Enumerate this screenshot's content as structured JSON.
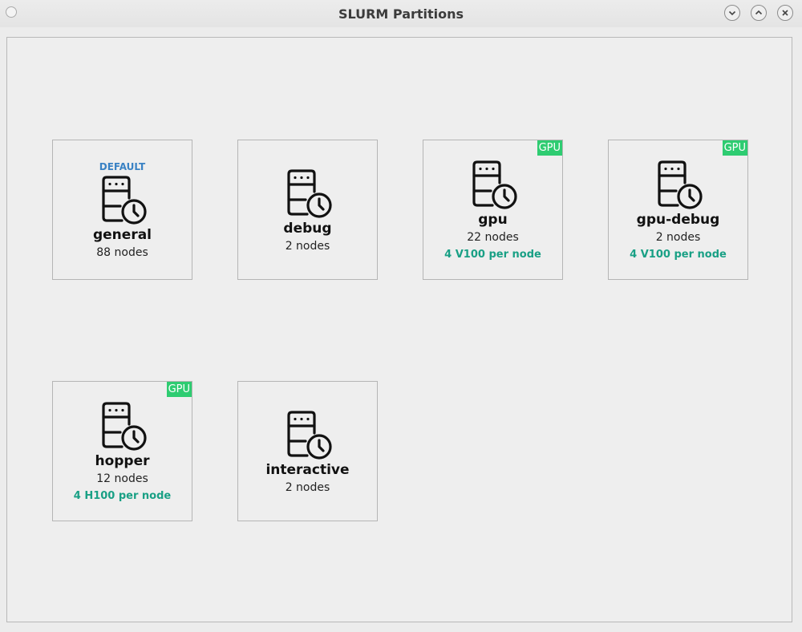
{
  "window": {
    "title": "SLURM Partitions",
    "controls": [
      "minimize-icon",
      "maximize-icon",
      "close-icon"
    ]
  },
  "partitions": [
    {
      "name": "general",
      "nodes": "88 nodes",
      "default_label": "DEFAULT",
      "gpu_tag": "",
      "gpu_info": ""
    },
    {
      "name": "debug",
      "nodes": "2 nodes",
      "default_label": "",
      "gpu_tag": "",
      "gpu_info": ""
    },
    {
      "name": "gpu",
      "nodes": "22 nodes",
      "default_label": "",
      "gpu_tag": "GPU",
      "gpu_info": "4 V100 per node"
    },
    {
      "name": "gpu-debug",
      "nodes": "2 nodes",
      "default_label": "",
      "gpu_tag": "GPU",
      "gpu_info": "4 V100 per node"
    },
    {
      "name": "hopper",
      "nodes": "12 nodes",
      "default_label": "",
      "gpu_tag": "GPU",
      "gpu_info": "4 H100 per node"
    },
    {
      "name": "interactive",
      "nodes": "2 nodes",
      "default_label": "",
      "gpu_tag": "",
      "gpu_info": ""
    }
  ],
  "colors": {
    "default_badge": "#3a82c4",
    "gpu_tag_bg": "#2ecc71",
    "gpu_info_text": "#19a085"
  },
  "partition_icon": "server-clock-icon"
}
